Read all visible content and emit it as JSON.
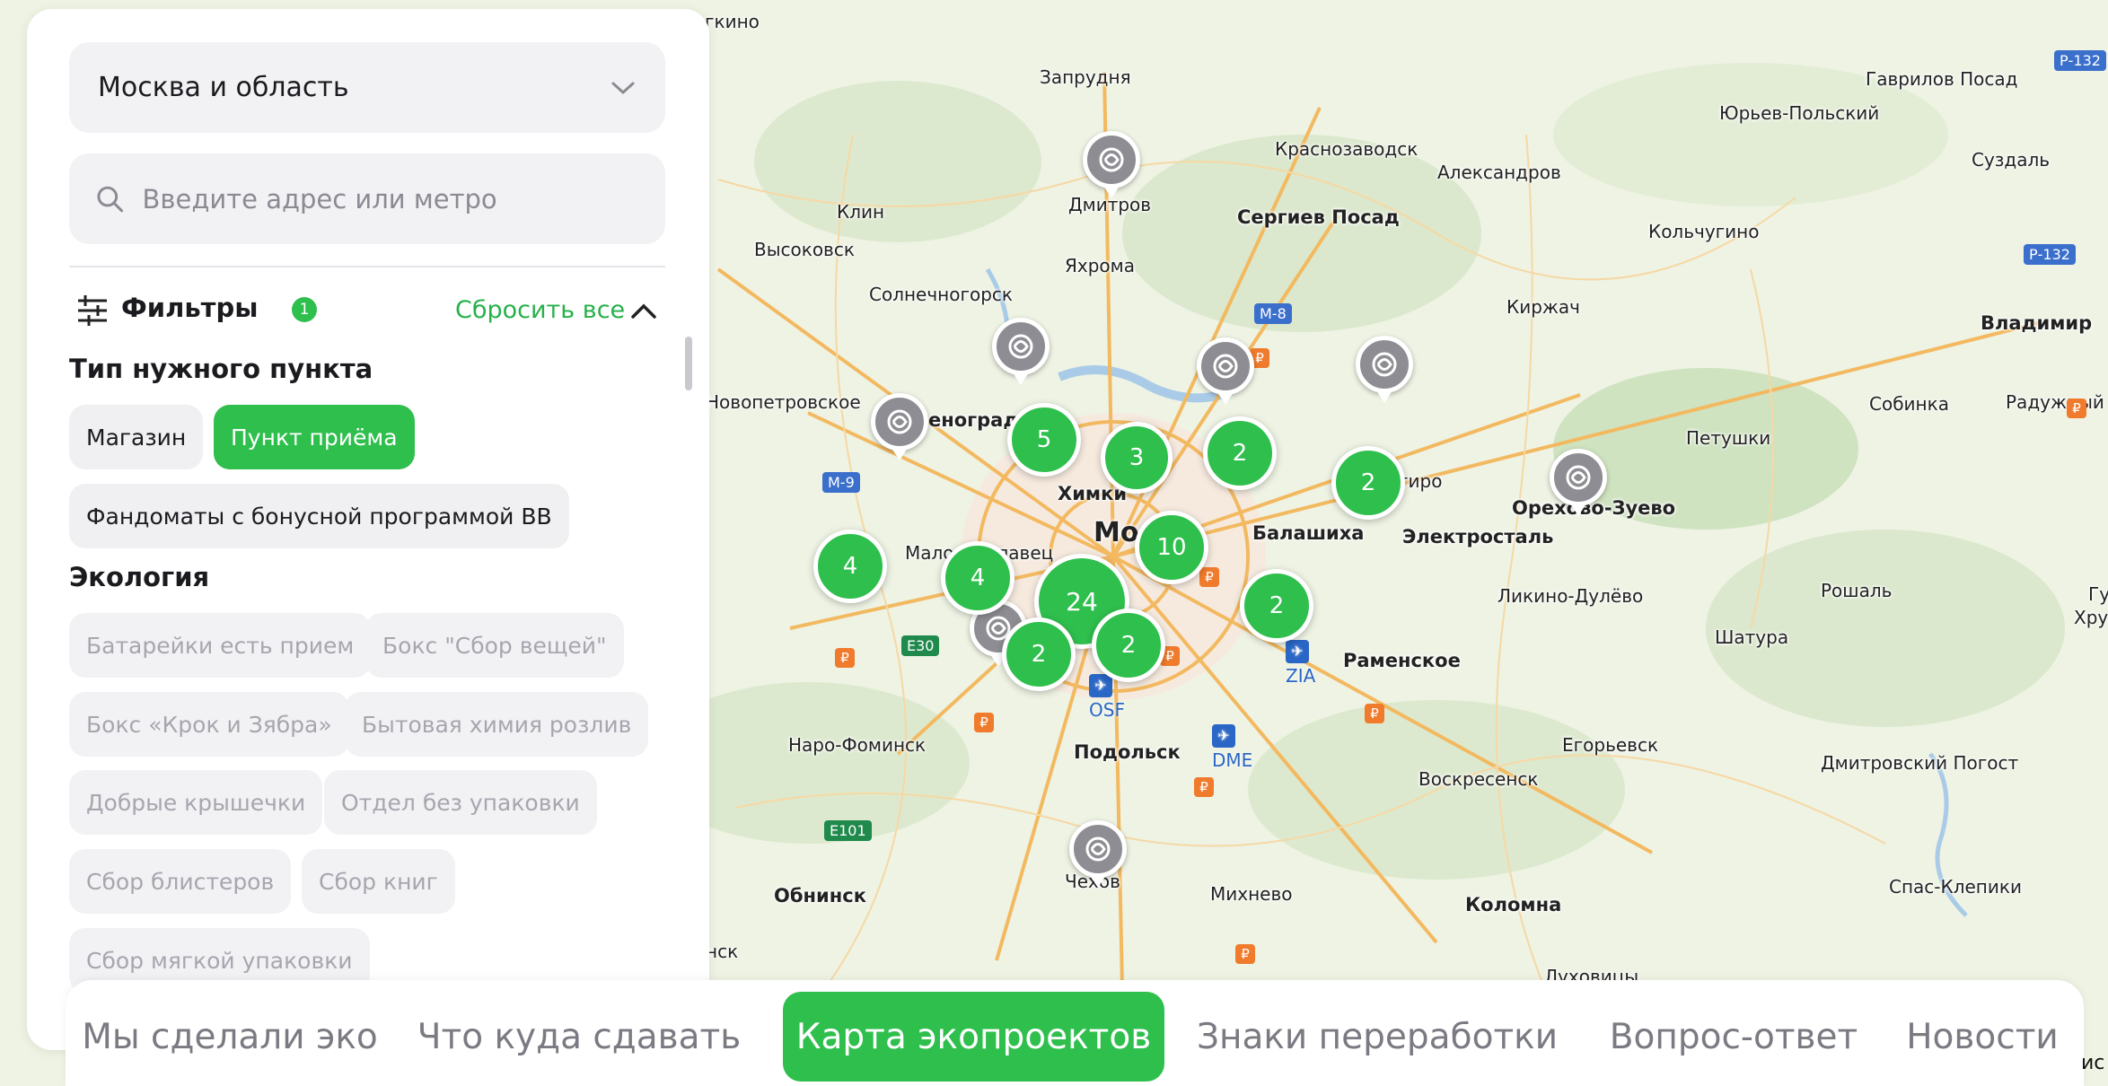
{
  "sidebar": {
    "region": "Москва и область",
    "search_placeholder": "Введите адрес или метро",
    "filters_label": "Фильтры",
    "filters_count": "1",
    "reset_label": "Сбросить все",
    "type_section_title": "Тип нужного пункта",
    "type_chips": [
      "Магазин",
      "Пункт приёма",
      "Фандоматы с бонусной программой ВВ"
    ],
    "ecology_section_title": "Экология",
    "ecology_chips": [
      "Батарейки есть прием",
      "Бокс \"Сбор вещей\"",
      "Бокс «Крок и Зябра»",
      "Бытовая химия розлив",
      "Добрые крышечки",
      "Отдел без упаковки",
      "Сбор блистеров",
      "Сбор книг",
      "Сбор мягкой упаковки"
    ]
  },
  "nav": {
    "items": [
      "Мы сделали эко",
      "Что куда сдавать",
      "Карта экопроектов",
      "Знаки переработки",
      "Вопрос-ответ",
      "Новости"
    ],
    "active": "Карта экопроектов"
  },
  "map": {
    "cities": [
      "Запрудня",
      "Гаврилов Посад",
      "Юрьев-Польский",
      "Суздаль",
      "Краснозаводск",
      "Александров",
      "Клин",
      "Дмитров",
      "Сергиев Посад",
      "Высоковск",
      "Кольчугино",
      "Яхрома",
      "Солнечногорск",
      "Киржач",
      "Владимир",
      "Новопетровское",
      "Собинка",
      "Радужный",
      "еноград",
      "Петушки",
      "Химки",
      "Мо",
      "Балашиха",
      "Электросталь",
      "Орехово-Зуево",
      "Ликино-Дулёво",
      "Рошаль",
      "Раменское",
      "Шатура",
      "Наро-Фоминск",
      "Подольск",
      "Егорьевск",
      "Дмитровский Погост",
      "Воскресенск",
      "Обнинск",
      "Чехов",
      "Михнево",
      "Коломна",
      "Спас-Клепики",
      "Малоярославец",
      "гиро",
      "нск",
      "гкино",
      "Хруст",
      "Гу",
      "Луховицы"
    ],
    "route_shields": [
      "М-8",
      "М-9",
      "Е30",
      "Е101",
      "Р-132",
      "Р-132"
    ],
    "airports": [
      "OSF",
      "DME",
      "ZIA"
    ],
    "clusters": [
      "5",
      "3",
      "2",
      "2",
      "4",
      "10",
      "4",
      "24",
      "2",
      "2",
      "2"
    ],
    "corner_text": "ис"
  }
}
